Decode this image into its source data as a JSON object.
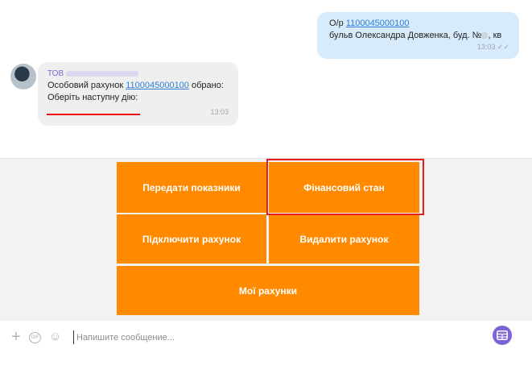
{
  "messages": {
    "outgoing": {
      "prefix": "О/р ",
      "account_link": "1100045000100",
      "address": "бульв Олександра Довженка, буд. №",
      "address_suffix": ", кв",
      "time": "13:03",
      "status_icon": "double-check-icon"
    },
    "incoming": {
      "sender_prefix": "ТОВ",
      "text_before_link": "Особовий рахунок ",
      "account_link": "1100045000100",
      "text_after_link": " обрано:",
      "action_text": "Оберіть наступну дію:",
      "time": "13:03"
    }
  },
  "keyboard": {
    "buttons": [
      {
        "label": "Передати показники"
      },
      {
        "label": "Фінансовий стан"
      },
      {
        "label": "Підключити рахунок"
      },
      {
        "label": "Видалити рахунок"
      },
      {
        "label": "Мої рахунки"
      }
    ],
    "accent": "#ff8a00",
    "highlight_color": "#e51c1c"
  },
  "composer": {
    "placeholder": "Напишите сообщение...",
    "value": "",
    "gif_label": "GIF",
    "icons": [
      "plus-icon",
      "gif-icon",
      "sticker-icon",
      "keyboard-toggle-icon"
    ]
  }
}
